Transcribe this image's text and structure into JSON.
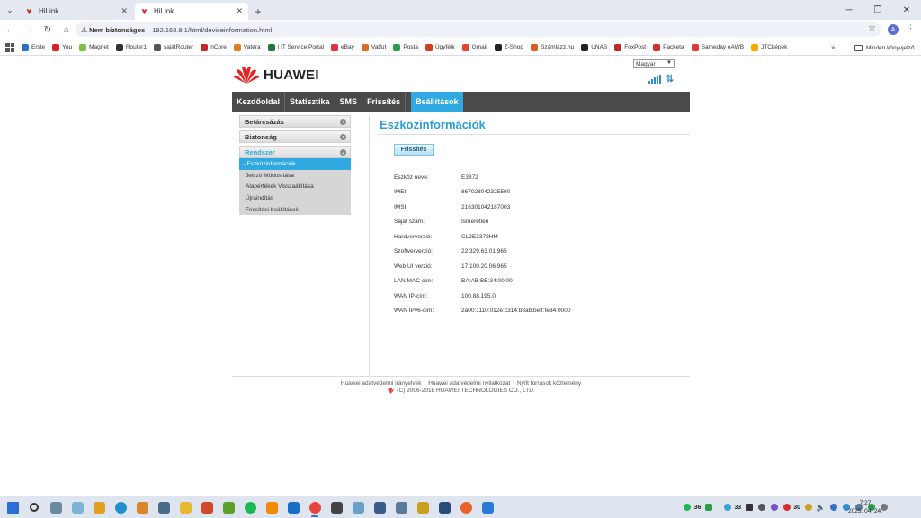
{
  "browser": {
    "tabs": [
      {
        "title": "HiLink",
        "active": false
      },
      {
        "title": "HiLink",
        "active": true
      }
    ],
    "address": {
      "security_label": "Nem biztonságos",
      "url": "192.168.8.1/html/deviceinformation.html"
    },
    "profile_initial": "A",
    "bookmarks": [
      {
        "label": "Erste",
        "color": "#2870c8"
      },
      {
        "label": "You",
        "color": "#e02020"
      },
      {
        "label": "Magnet",
        "color": "#7cc242"
      },
      {
        "label": "Router1",
        "color": "#333333"
      },
      {
        "label": "sajátRouter",
        "color": "#555555"
      },
      {
        "label": "nCore",
        "color": "#c62828"
      },
      {
        "label": "Vatera",
        "color": "#e57c1a"
      },
      {
        "label": "| IT Service Portal",
        "color": "#1b7a3a"
      },
      {
        "label": "eBay",
        "color": "#e53238"
      },
      {
        "label": "Vatfut",
        "color": "#e07020"
      },
      {
        "label": "Posta",
        "color": "#2a9d4a"
      },
      {
        "label": "Ügyfélk",
        "color": "#d04020"
      },
      {
        "label": "Gmail",
        "color": "#ea4335"
      },
      {
        "label": "Z-Shop",
        "color": "#222222"
      },
      {
        "label": "Számlázz.hu",
        "color": "#d86020"
      },
      {
        "label": "UNAS",
        "color": "#222222"
      },
      {
        "label": "FoxPost",
        "color": "#c62828"
      },
      {
        "label": "Packeta",
        "color": "#d32f2f"
      },
      {
        "label": "Sameday eAWB",
        "color": "#e53935"
      },
      {
        "label": "JTCképek",
        "color": "#f2a900"
      }
    ],
    "bookmarks_more": "»",
    "all_bookmarks": "Minden könyvjelző"
  },
  "hilink": {
    "brand": "HUAWEI",
    "language": "Magyar",
    "nav": [
      {
        "label": "Kezdőoldal",
        "active": false
      },
      {
        "label": "Statisztika",
        "active": false
      },
      {
        "label": "SMS",
        "active": false
      },
      {
        "label": "Frissítés",
        "active": false
      },
      {
        "label": "Beállítások",
        "active": true
      }
    ],
    "sidebar": {
      "sections": [
        {
          "label": "Betárcsázás"
        },
        {
          "label": "Biztonság"
        },
        {
          "label": "Rendszer"
        }
      ],
      "system_items": [
        {
          "label": "Eszközinformációk",
          "active": true
        },
        {
          "label": "Jelszó Módosítása",
          "active": false
        },
        {
          "label": "Alapértékek Visszaállítása",
          "active": false
        },
        {
          "label": "Újraindítás",
          "active": false
        },
        {
          "label": "Frissítési beállítások",
          "active": false
        }
      ]
    },
    "page_title": "Eszközinformációk",
    "refresh_label": "Frissítés",
    "device_info": [
      {
        "label": "Eszköz neve:",
        "value": "E3372"
      },
      {
        "label": "IMEI:",
        "value": "867028042325590"
      },
      {
        "label": "IMSI:",
        "value": "216301042187003"
      },
      {
        "label": "Saját szám:",
        "value": "Ismeretlen"
      },
      {
        "label": "Hardververzió:",
        "value": "CL2E3372HM"
      },
      {
        "label": "Szoftver​verzió:",
        "value": "22.329.63.01.965"
      },
      {
        "label": "Web UI verzió:",
        "value": "17.100.20.06.965"
      },
      {
        "label": "LAN MAC-cím:",
        "value": "BA:AB:BE:34:00:00"
      },
      {
        "label": "WAN IP-cím:",
        "value": "100.88.195.0"
      },
      {
        "label": "WAN IPv6-cím:",
        "value": "2a00:1110:012e:c314:b8ab:beff:fe34:0000"
      }
    ],
    "footer": {
      "links": [
        "Huawei adatvédelmi irányelvek",
        "Huawei adatvédelmi nyilatkozat",
        "Nyílt források közlemény"
      ],
      "copyright": "(C) 2006-2018 HUAWEI TECHNOLOGIES CO., LTD."
    }
  },
  "taskbar": {
    "apps": [
      {
        "icon": "windows-start-icon",
        "color": "#2b6fd6"
      },
      {
        "icon": "search-icon",
        "color": "#333333"
      },
      {
        "icon": "app-icon",
        "color": "#6a8aa0"
      },
      {
        "icon": "app-icon",
        "color": "#7fb3d5"
      },
      {
        "icon": "app-icon",
        "color": "#e0a020"
      },
      {
        "icon": "edge-icon",
        "color": "#1f8fcf"
      },
      {
        "icon": "app-icon",
        "color": "#d8882a"
      },
      {
        "icon": "calculator-icon",
        "color": "#4a6a8a"
      },
      {
        "icon": "folder-icon",
        "color": "#e8b830"
      },
      {
        "icon": "app-icon",
        "color": "#d04a2a"
      },
      {
        "icon": "app-icon",
        "color": "#5aa02a"
      },
      {
        "icon": "spotify-icon",
        "color": "#1db954"
      },
      {
        "icon": "vlc-icon",
        "color": "#f08a00"
      },
      {
        "icon": "app-icon",
        "color": "#1a6ec8"
      },
      {
        "icon": "chrome-icon",
        "color": "#e8453c"
      },
      {
        "icon": "app-icon",
        "color": "#444444"
      },
      {
        "icon": "app-icon",
        "color": "#6aa0c8"
      },
      {
        "icon": "app-icon",
        "color": "#3a5a8a"
      },
      {
        "icon": "app-icon",
        "color": "#5a7a9a"
      },
      {
        "icon": "app-icon",
        "color": "#caa020"
      },
      {
        "icon": "app-icon",
        "color": "#2a4a7a"
      },
      {
        "icon": "firefox-icon",
        "color": "#e8632a"
      },
      {
        "icon": "app-icon",
        "color": "#2a7ad8"
      }
    ],
    "tray": {
      "badge_a": "36",
      "badge_b": "33",
      "badge_c": "30"
    },
    "clock": {
      "time": "7:27",
      "date": "2025. 04. 24."
    }
  }
}
